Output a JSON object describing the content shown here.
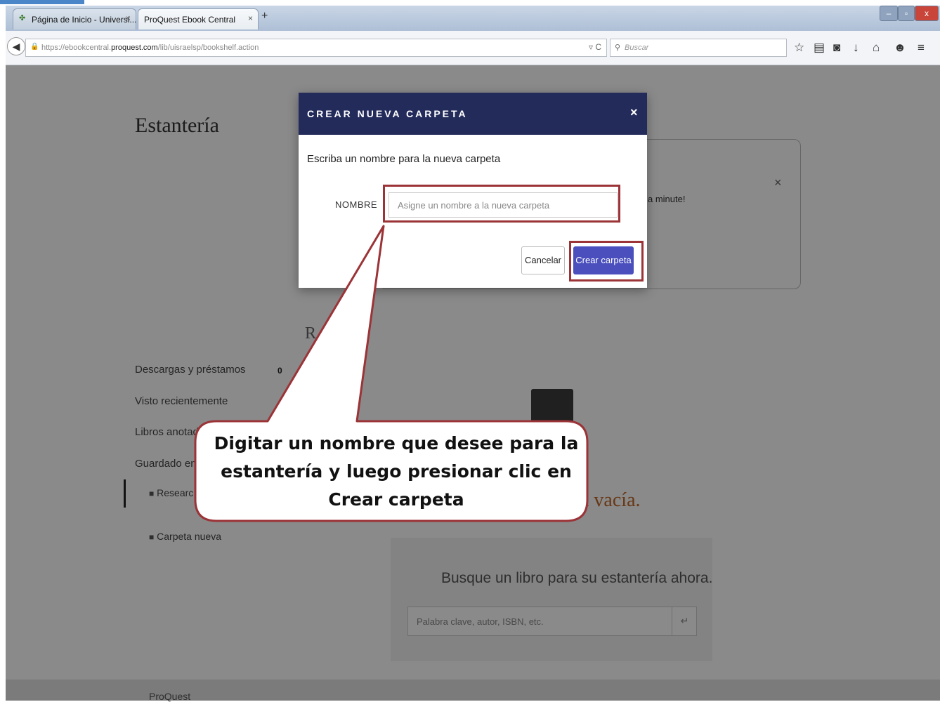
{
  "browser": {
    "tabs": [
      {
        "label": "Página de Inicio - Universi...",
        "close": "×"
      },
      {
        "label": "ProQuest Ebook Central",
        "close": "×"
      }
    ],
    "new_tab": "+",
    "window_controls": [
      "‒",
      "▫",
      "x"
    ],
    "url_prefix": "https://ebookcentral.",
    "url_domain": "proquest.com",
    "url_path": "/lib/uisraelsp/bookshelf.action",
    "search_placeholder": "Buscar",
    "reload": "▿ C"
  },
  "page": {
    "title": "Estantería",
    "message_tail": "a minute!",
    "message_close": "×",
    "sidebar": {
      "downloads": "Descargas y préstamos",
      "downloads_count": "0",
      "recent": "Visto recientemente",
      "annotated": "Libros anotad",
      "saved_in": "Guardado en",
      "research_folder": "Researc",
      "new_folder": "Carpeta nueva"
    },
    "section_letter": "R",
    "empty_tail": "á vacía.",
    "search_prompt": "Busque un libro para su estantería ahora.",
    "search_placeholder": "Palabra clave, autor, ISBN, etc.",
    "footer_text": "ProQuest"
  },
  "modal": {
    "title": "CREAR NUEVA CARPETA",
    "close": "×",
    "prompt": "Escriba un nombre para la nueva carpeta",
    "name_label": "NOMBRE",
    "name_placeholder": "Asigne un nombre a la nueva carpeta",
    "cancel_label": "Cancelar",
    "create_label": "Crear carpeta"
  },
  "callout": {
    "line1": "Digitar un nombre que desee para la",
    "line2": "estantería y luego presionar clic en",
    "line3": "Crear carpeta"
  },
  "colors": {
    "modal_header": "#232b5b",
    "create_button": "#4a4fbd",
    "highlight": "#9b3337",
    "empty_text": "#c0682a"
  }
}
